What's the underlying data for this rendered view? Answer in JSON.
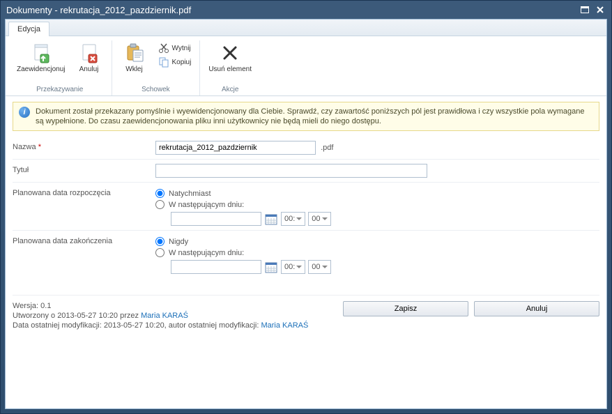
{
  "window": {
    "title": "Dokumenty - rekrutacja_2012_pazdziernik.pdf"
  },
  "tabs": {
    "edit": "Edycja"
  },
  "ribbon": {
    "przekazywanie": {
      "label": "Przekazywanie",
      "zaewidencjonuj": "Zaewidencjonuj",
      "anuluj": "Anuluj"
    },
    "schowek": {
      "label": "Schowek",
      "wklej": "Wklej",
      "wytnij": "Wytnij",
      "kopiuj": "Kopiuj"
    },
    "akcje": {
      "label": "Akcje",
      "usun": "Usuń element"
    }
  },
  "banner": {
    "text": "Dokument został przekazany pomyślnie i wyewidencjonowany dla Ciebie. Sprawdź, czy zawartość poniższych pól jest prawidłowa i czy wszystkie pola wymagane są wypełnione. Do czasu zaewidencjonowania pliku inni użytkownicy nie będą mieli do niego dostępu."
  },
  "form": {
    "name_label": "Nazwa",
    "name_value": "rekrutacja_2012_pazdziernik",
    "name_ext": ".pdf",
    "title_label": "Tytuł",
    "title_value": "",
    "start_label": "Planowana data rozpoczęcia",
    "start_opt1": "Natychmiast",
    "start_opt2": "W następującym dniu:",
    "start_date": "",
    "start_hour": "00:",
    "start_min": "00",
    "end_label": "Planowana data zakończenia",
    "end_opt1": "Nigdy",
    "end_opt2": "W następującym dniu:",
    "end_date": "",
    "end_hour": "00:",
    "end_min": "00"
  },
  "meta": {
    "version_label": "Wersja:",
    "version": "0.1",
    "created_prefix": "Utworzony o 2013-05-27 10:20 przez ",
    "created_user": "Maria KARAŚ",
    "modified_prefix": "Data ostatniej modyfikacji: 2013-05-27 10:20, autor ostatniej modyfikacji: ",
    "modified_user": "Maria KARAŚ"
  },
  "buttons": {
    "save": "Zapisz",
    "cancel": "Anuluj"
  }
}
